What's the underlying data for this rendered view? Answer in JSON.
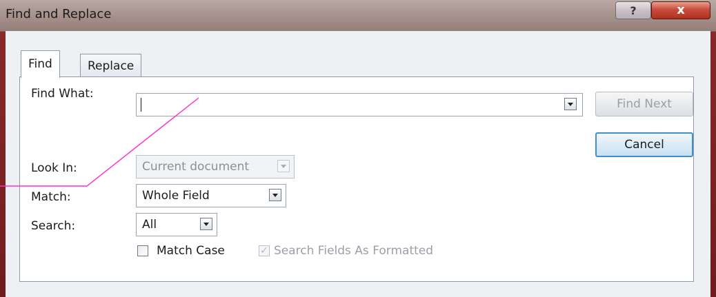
{
  "window": {
    "title": "Find and Replace",
    "help_glyph": "?",
    "close_glyph": "x"
  },
  "tabs": [
    {
      "label": "Find",
      "selected": true
    },
    {
      "label": "Replace",
      "selected": false
    }
  ],
  "form": {
    "find_what_label": "Find What:",
    "find_what_value": "",
    "look_in_label": "Look In:",
    "look_in_value": "Current document",
    "match_label": "Match:",
    "match_value": "Whole Field",
    "search_label": "Search:",
    "search_value": "All",
    "match_case_label": "Match Case",
    "match_case_checked": false,
    "search_formatted_label": "Search Fields As Formatted",
    "search_formatted_checked": true
  },
  "buttons": {
    "find_next": "Find Next",
    "cancel": "Cancel"
  },
  "colors": {
    "callout_line": "#ff2ad0",
    "default_button_border": "#3d8fd1"
  }
}
